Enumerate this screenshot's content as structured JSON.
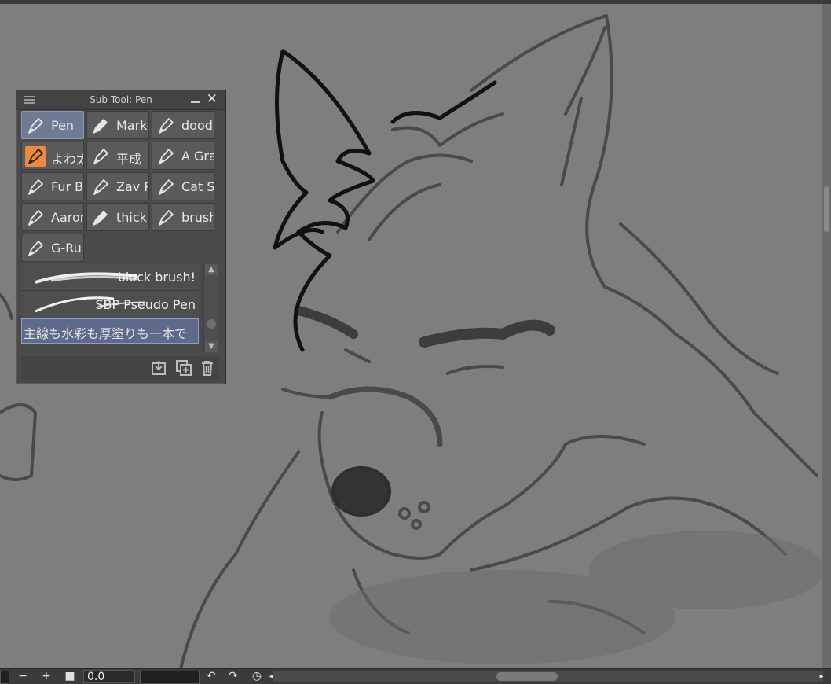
{
  "palette": {
    "title": "Sub Tool: Pen",
    "tools": [
      {
        "label": "Pen",
        "selected": true,
        "icon": "pen-nib-icon"
      },
      {
        "label": "Marke",
        "icon": "marker-icon"
      },
      {
        "label": "dood",
        "icon": "pen-nib-icon"
      },
      {
        "label": "よわ太",
        "icon": "pen-nib-icon",
        "accent": "#f08a3a"
      },
      {
        "label": "平成",
        "icon": "pen-nib-icon"
      },
      {
        "label": "A Gra",
        "icon": "pen-nib-icon"
      },
      {
        "label": "Fur B",
        "icon": "pen-nib-icon"
      },
      {
        "label": "Zav P",
        "icon": "pen-nib-icon"
      },
      {
        "label": "Cat S",
        "icon": "pen-nib-icon"
      },
      {
        "label": "Aaron",
        "icon": "pen-nib-icon"
      },
      {
        "label": "thickp",
        "icon": "marker-icon"
      },
      {
        "label": "brush",
        "icon": "pen-nib-icon"
      },
      {
        "label": "G-Ru",
        "icon": "pen-nib-icon"
      }
    ],
    "brushes": [
      {
        "name": "block brush!"
      },
      {
        "name": "SBP Pseudo Pen"
      },
      {
        "name": "主線も水彩も厚塗りも一本で",
        "selected": true
      }
    ]
  },
  "statusbar": {
    "zoom_out": "−",
    "zoom_in": "+",
    "angle_value": "0.0"
  }
}
